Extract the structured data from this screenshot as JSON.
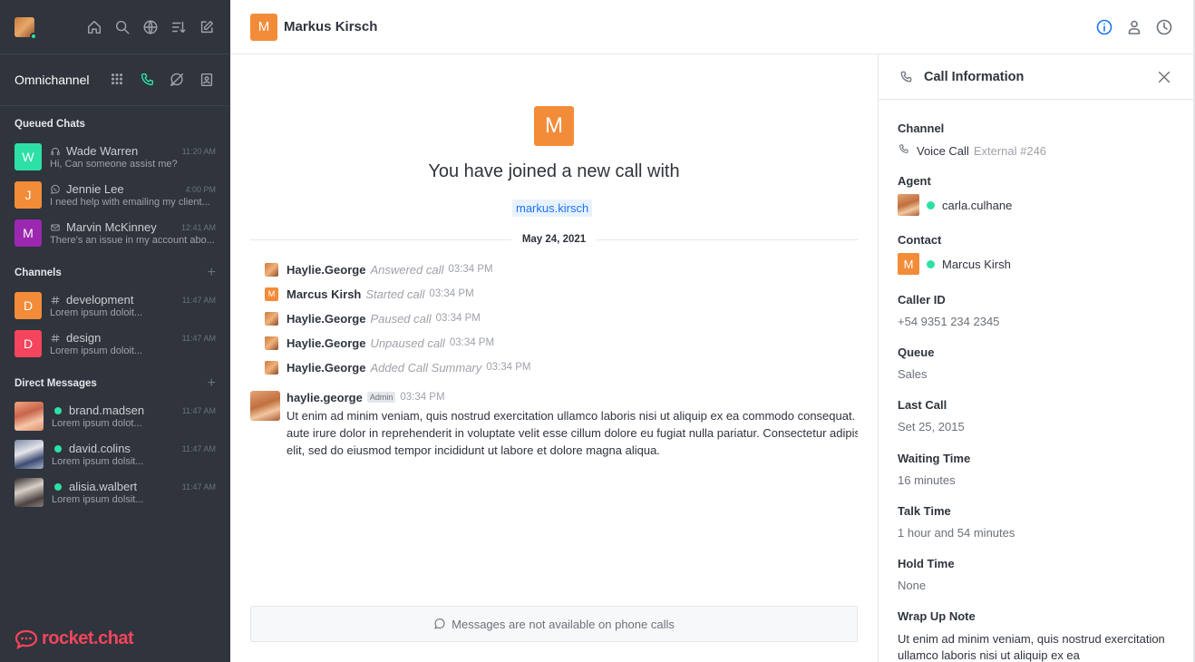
{
  "sidebar": {
    "omnichannel_title": "Omnichannel",
    "queued_title": "Queued Chats",
    "queued": [
      {
        "initial": "W",
        "color": "#2de0a5",
        "icon": "headset-icon",
        "name": "Wade Warren",
        "time": "11:20 AM",
        "preview": "Hi, Can someone assist me?"
      },
      {
        "initial": "J",
        "color": "#f38c39",
        "icon": "whatsapp-icon",
        "name": "Jennie Lee",
        "time": "4:00 PM",
        "preview": "I need help with emailing my client..."
      },
      {
        "initial": "M",
        "color": "#9c27b0",
        "icon": "mail-icon",
        "name": "Marvin McKinney",
        "time": "12:41 AM",
        "preview": "There's an issue in my account abo..."
      }
    ],
    "channels_title": "Channels",
    "channels": [
      {
        "initial": "D",
        "color": "#f38c39",
        "icon": "hashtag-icon",
        "name": "development",
        "time": "11:47 AM",
        "preview": "Lorem ipsum doloit..."
      },
      {
        "initial": "D",
        "color": "#f5455c",
        "icon": "hashtag-icon",
        "name": "design",
        "time": "11:47 AM",
        "preview": "Lorem ipsum doloit..."
      }
    ],
    "dm_title": "Direct Messages",
    "dms": [
      {
        "name": "brand.madsen",
        "time": "11:47 AM",
        "preview": "Lorem ipsum dolot..."
      },
      {
        "name": "david.colins",
        "time": "11:47 AM",
        "preview": "Lorem ipsum dolsit..."
      },
      {
        "name": "alisia.walbert",
        "time": "11:47 AM",
        "preview": "Lorem ipsum dolsit..."
      }
    ],
    "brand": "rocket.chat"
  },
  "header": {
    "initial": "M",
    "title": "Markus Kirsch"
  },
  "conversation": {
    "avatar_initial": "M",
    "joined_text": "You have joined a new call with",
    "mention": "markus.kirsch",
    "date": "May 24, 2021",
    "system_messages": [
      {
        "user": "Haylie.George",
        "action": "Answered call",
        "time": "03:34 PM",
        "avatar": "photo"
      },
      {
        "user": "Marcus Kirsh",
        "action": "Started call",
        "time": "03:34 PM",
        "avatar": "M"
      },
      {
        "user": "Haylie.George",
        "action": "Paused call",
        "time": "03:34 PM",
        "avatar": "photo"
      },
      {
        "user": "Haylie.George",
        "action": "Unpaused call",
        "time": "03:34 PM",
        "avatar": "photo"
      },
      {
        "user": "Haylie.George",
        "action": "Added Call Summary",
        "time": "03:34 PM",
        "avatar": "photo"
      }
    ],
    "message": {
      "user": "haylie.george",
      "badge": "Admin",
      "time": "03:34 PM",
      "lines": [
        "Ut enim ad minim veniam, quis nostrud exercitation ullamco laboris nisi ut aliquip ex ea commodo consequat. Duis",
        "aute irure dolor in reprehenderit in voluptate velit esse cillum dolore eu fugiat nulla pariatur. Consectetur adipiscing",
        "elit, sed do eiusmod tempor incididunt ut labore et dolore magna aliqua."
      ]
    },
    "composer_text": "Messages are not available on phone calls"
  },
  "panel": {
    "title": "Call Information",
    "channel_label": "Channel",
    "channel_value": "Voice Call",
    "channel_extra": "External #246",
    "agent_label": "Agent",
    "agent_value": "carla.culhane",
    "contact_label": "Contact",
    "contact_initial": "M",
    "contact_value": "Marcus Kirsh",
    "callerid_label": "Caller ID",
    "callerid_value": "+54 9351 234 2345",
    "queue_label": "Queue",
    "queue_value": "Sales",
    "lastcall_label": "Last Call",
    "lastcall_value": "Set 25, 2015",
    "waiting_label": "Waiting Time",
    "waiting_value": "16 minutes",
    "talk_label": "Talk Time",
    "talk_value": "1 hour and 54 minutes",
    "hold_label": "Hold Time",
    "hold_value": "None",
    "wrap_label": "Wrap Up Note",
    "wrap_value": "Ut enim ad minim veniam, quis nostrud exercitation ullamco laboris nisi ut aliquip ex ea"
  }
}
